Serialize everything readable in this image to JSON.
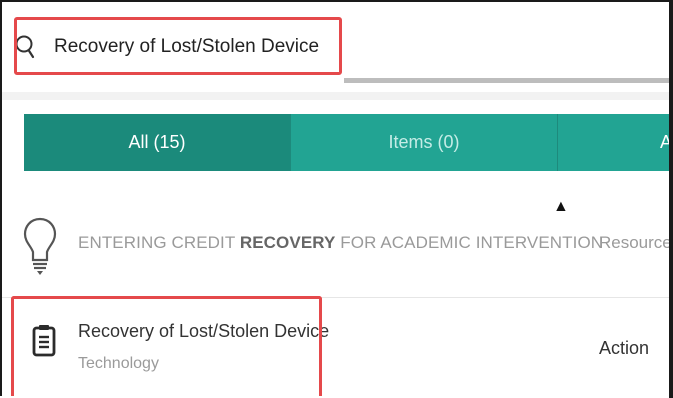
{
  "search": {
    "value": "Recovery of Lost/Stolen Device",
    "icon": "search-icon"
  },
  "tabs": [
    {
      "label": "All (15)"
    },
    {
      "label": "Items (0)"
    },
    {
      "label": "A"
    }
  ],
  "results": [
    {
      "icon": "lightbulb-icon",
      "title_prefix": "ENTERING CREDIT ",
      "title_bold": "RECOVERY",
      "title_suffix": " FOR ACADEMIC INTERVENTION",
      "type": "Resource"
    },
    {
      "icon": "clipboard-icon",
      "title": "Recovery of Lost/Stolen Device",
      "subtitle": "Technology",
      "type": "Action"
    }
  ],
  "colors": {
    "tab_active": "#1b8a7b",
    "tab_inactive": "#22a493",
    "highlight": "#e5494b"
  },
  "sort_indicator": "▲"
}
